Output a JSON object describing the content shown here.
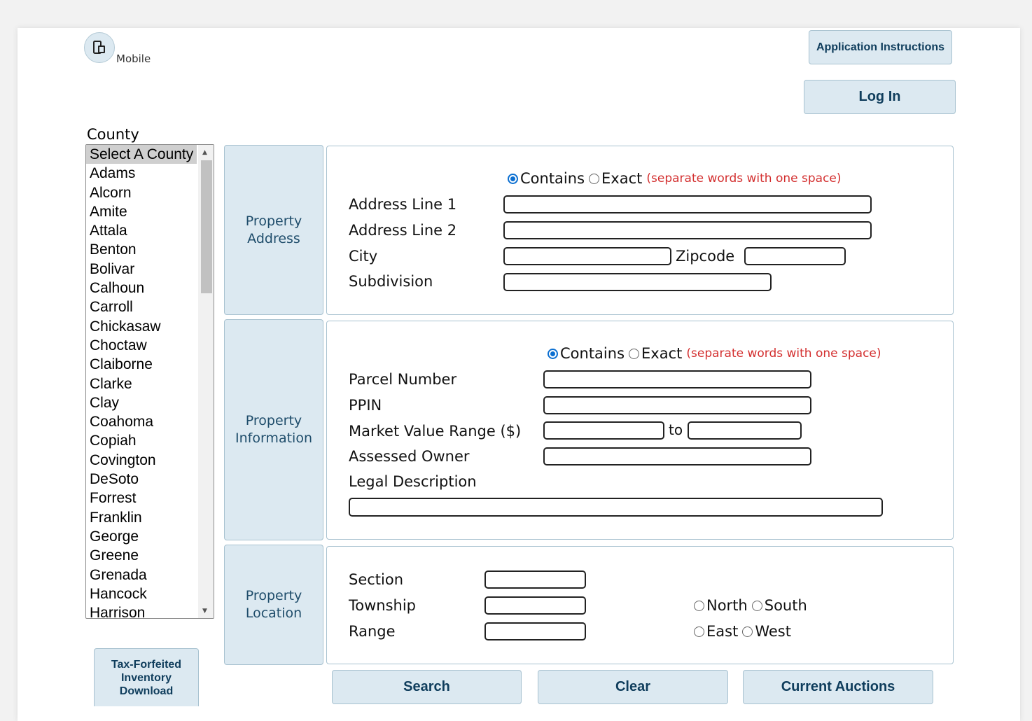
{
  "header": {
    "mobile_label": "Mobile",
    "instructions_button": "Application Instructions",
    "login_button": "Log In"
  },
  "county": {
    "label": "County",
    "items": [
      "Select A County",
      "Adams",
      "Alcorn",
      "Amite",
      "Attala",
      "Benton",
      "Bolivar",
      "Calhoun",
      "Carroll",
      "Chickasaw",
      "Choctaw",
      "Claiborne",
      "Clarke",
      "Clay",
      "Coahoma",
      "Copiah",
      "Covington",
      "DeSoto",
      "Forrest",
      "Franklin",
      "George",
      "Greene",
      "Grenada",
      "Hancock",
      "Harrison"
    ],
    "selected": "Select A County"
  },
  "forfeit_button": [
    "Tax-Forfeited",
    "Inventory",
    "Download"
  ],
  "address": {
    "tab": [
      "Property",
      "Address"
    ],
    "match_contains": "Contains",
    "match_exact": "Exact",
    "note": "(separate words with one space)",
    "address1_label": "Address Line 1",
    "address2_label": "Address Line 2",
    "city_label": "City",
    "zip_label": "Zipcode",
    "subdivision_label": "Subdivision"
  },
  "info": {
    "tab": [
      "Property",
      "Information"
    ],
    "match_contains": "Contains",
    "match_exact": "Exact",
    "note": "(separate words with one space)",
    "parcel_label": "Parcel Number",
    "ppin_label": "PPIN",
    "market_label": "Market Value Range ($)",
    "to_label": "to",
    "owner_label": "Assessed Owner",
    "legal_label": "Legal Description"
  },
  "location": {
    "tab": [
      "Property",
      "Location"
    ],
    "section_label": "Section",
    "township_label": "Township",
    "range_label": "Range",
    "north": "North",
    "south": "South",
    "east": "East",
    "west": "West"
  },
  "actions": {
    "search": "Search",
    "clear": "Clear",
    "auctions": "Current Auctions"
  },
  "colors": {
    "button_bg": "#dce9f1",
    "button_text": "#0f3d5c",
    "note": "#d32f2f",
    "radio_checked": "#0b6fd1"
  }
}
